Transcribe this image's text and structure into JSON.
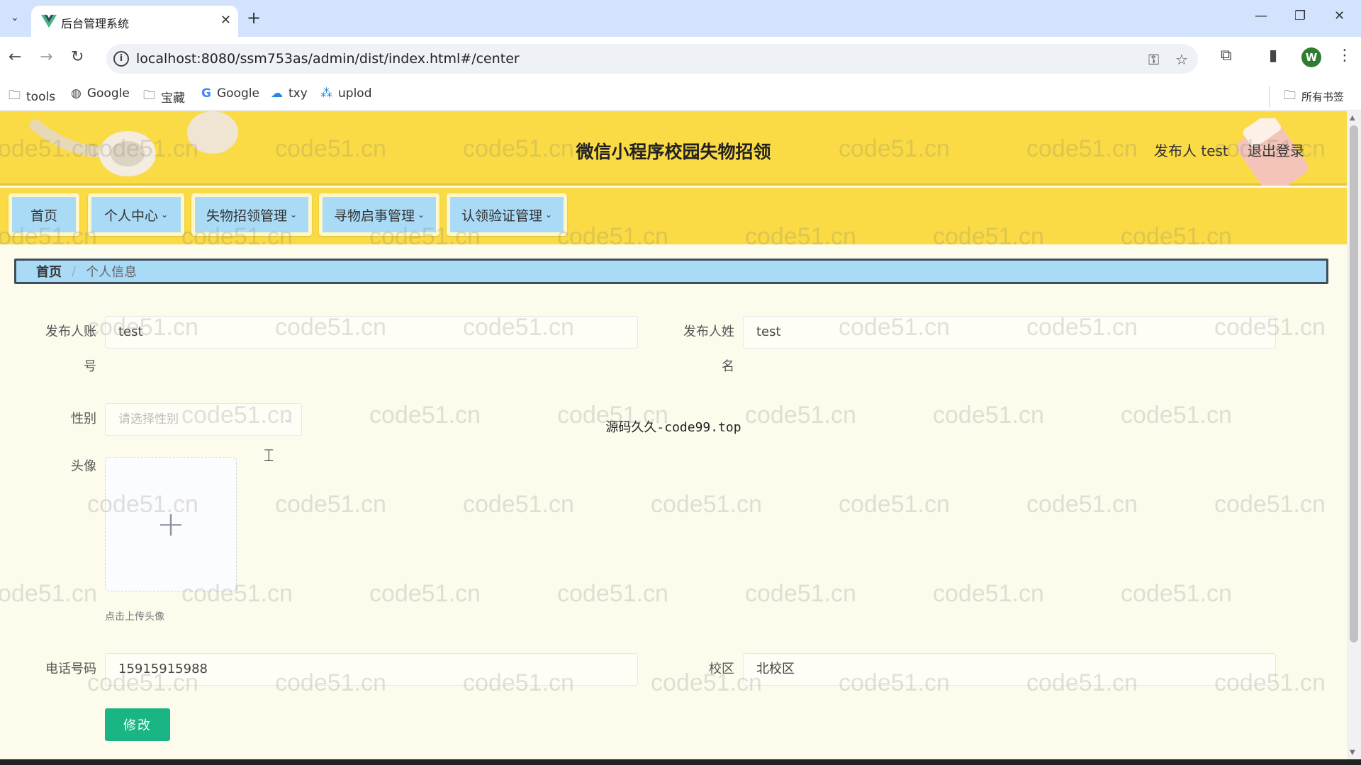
{
  "browser": {
    "tab_title": "后台管理系统",
    "url": "localhost:8080/ssm753as/admin/dist/index.html#/center",
    "bookmarks": [
      {
        "label": "tools",
        "icon": "folder-icon"
      },
      {
        "label": "Google",
        "icon": "globe-icon"
      },
      {
        "label": "宝藏",
        "icon": "folder-icon"
      },
      {
        "label": "Google",
        "icon": "google-icon"
      },
      {
        "label": "txy",
        "icon": "cloud-icon"
      },
      {
        "label": "uplod",
        "icon": "uplod-icon"
      }
    ],
    "all_bookmarks": "所有书签",
    "profile_initial": "W"
  },
  "header": {
    "title": "微信小程序校园失物招领",
    "user": "发布人 test",
    "logout": "退出登录"
  },
  "nav": {
    "items": [
      {
        "label": "首页"
      },
      {
        "label": "个人中心"
      },
      {
        "label": "失物招领管理"
      },
      {
        "label": "寻物启事管理"
      },
      {
        "label": "认领验证管理"
      }
    ]
  },
  "breadcrumb": {
    "home": "首页",
    "separator": "/",
    "current": "个人信息"
  },
  "form": {
    "account_label_1": "发布人账",
    "account_label_2": "号",
    "account_value": "test",
    "name_label_1": "发布人姓",
    "name_label_2": "名",
    "name_value": "test",
    "gender_label": "性别",
    "gender_placeholder": "请选择性别",
    "avatar_label": "头像",
    "avatar_tip": "点击上传头像",
    "phone_label": "电话号码",
    "phone_value": "15915915988",
    "campus_label": "校区",
    "campus_value": "北校区",
    "submit_label": "修改"
  },
  "overlay_text": "源码久久-code99.top",
  "watermark": "code51.cn",
  "colors": {
    "header_bg": "#fadb45",
    "nav_button_bg": "#a9dbf7",
    "submit_bg": "#19b585",
    "page_bg": "#fdfbec"
  }
}
